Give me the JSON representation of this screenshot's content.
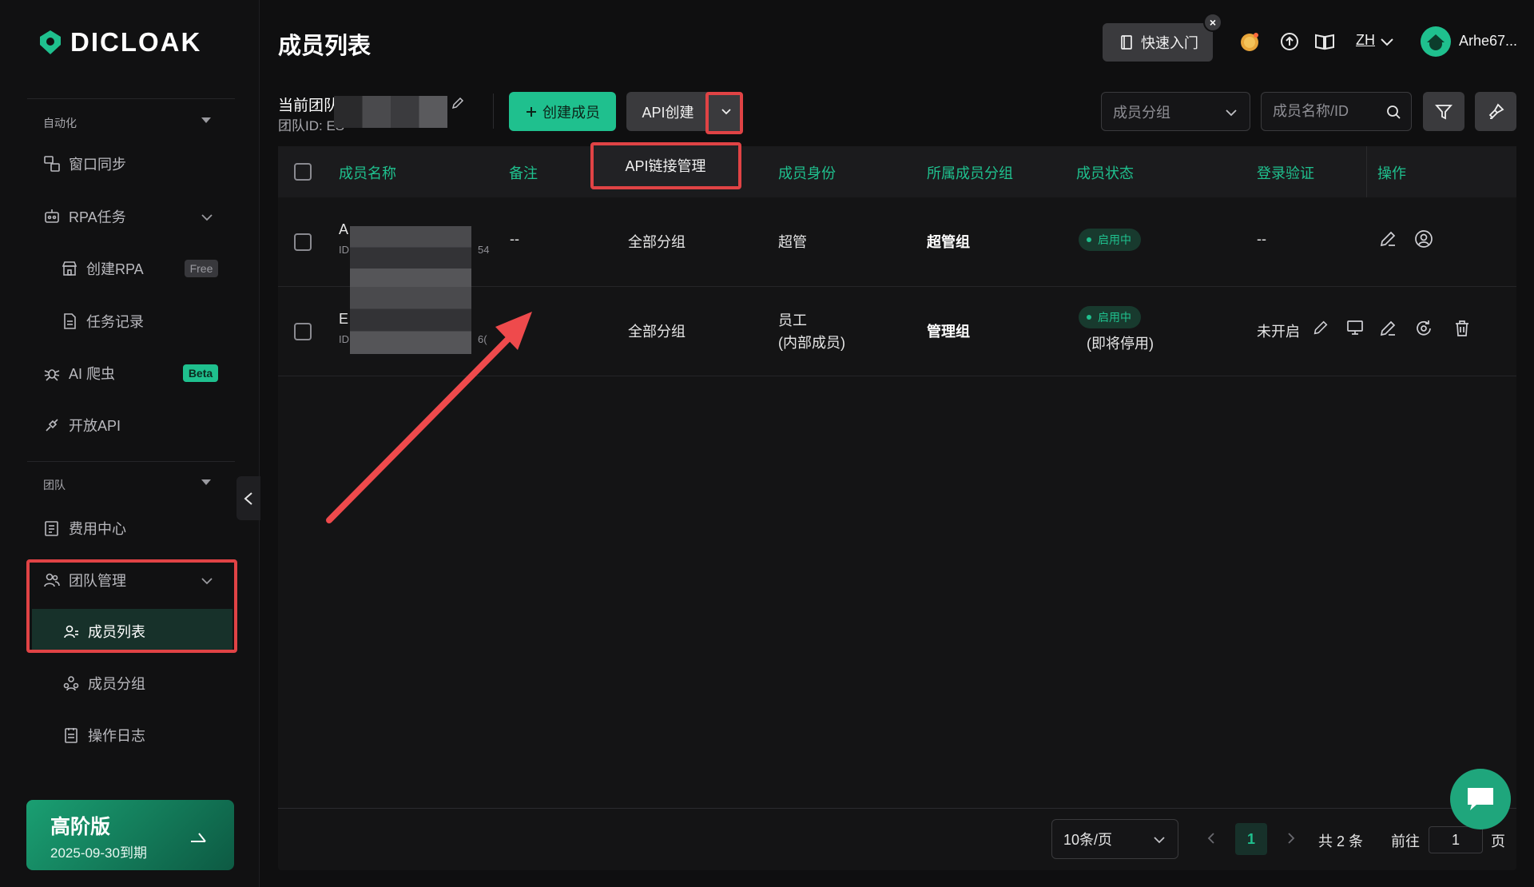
{
  "brand": {
    "name": "DICLOAK",
    "accent": "#1fc08e",
    "highlight": "#e04345"
  },
  "sidebar": {
    "sections": {
      "automation": "自动化",
      "team": "团队"
    },
    "items": [
      {
        "label": "窗口同步",
        "icon": "window-sync-icon"
      },
      {
        "label": "RPA任务",
        "icon": "robot-icon"
      },
      {
        "label": "创建RPA",
        "icon": "store-icon",
        "badge": "Free"
      },
      {
        "label": "任务记录",
        "icon": "document-icon"
      },
      {
        "label": "AI 爬虫",
        "icon": "spider-icon",
        "badge": "Beta"
      },
      {
        "label": "开放API",
        "icon": "api-icon"
      },
      {
        "label": "费用中心",
        "icon": "billing-icon"
      },
      {
        "label": "团队管理",
        "icon": "team-icon"
      },
      {
        "label": "成员列表",
        "icon": "member-icon",
        "active": true
      },
      {
        "label": "成员分组",
        "icon": "group-icon"
      },
      {
        "label": "操作日志",
        "icon": "log-icon"
      }
    ],
    "upgrade": {
      "plan": "高阶版",
      "expiry": "2025-09-30到期"
    }
  },
  "header": {
    "title": "成员列表",
    "quick_start": "快速入门",
    "lang": "ZH",
    "username": "Arhe67..."
  },
  "toolbar": {
    "team_label": "当前团队:",
    "team_id_label": "团队ID: ES",
    "create_member": "创建成员",
    "api_create": "API创建",
    "group_select": "成员分组",
    "search_placeholder": "成员名称/ID"
  },
  "dropdown": {
    "item": "API链接管理"
  },
  "table": {
    "columns": [
      "成员名称",
      "备注",
      "成员身份",
      "所属成员分组",
      "成员状态",
      "登录验证",
      "操作"
    ],
    "rows": [
      {
        "name_initial": "A",
        "id_prefix": "ID",
        "id_suffix": "54",
        "remark": "--",
        "group": "全部分组",
        "role": "超管",
        "role_sub": "",
        "member_group": "超管组",
        "status": "启用中",
        "status_note": "",
        "login_verify": "--"
      },
      {
        "name_initial": "E",
        "id_prefix": "ID",
        "id_suffix": "6(",
        "remark": "",
        "group": "全部分组",
        "role": "员工",
        "role_sub": "(内部成员)",
        "member_group": "管理组",
        "status": "启用中",
        "status_note": "(即将停用)",
        "login_verify": "未开启"
      }
    ]
  },
  "pagination": {
    "page_size": "10条/页",
    "current_page": "1",
    "total": "共 2 条",
    "goto_label": "前往",
    "goto_value": "1",
    "page_unit": "页"
  }
}
